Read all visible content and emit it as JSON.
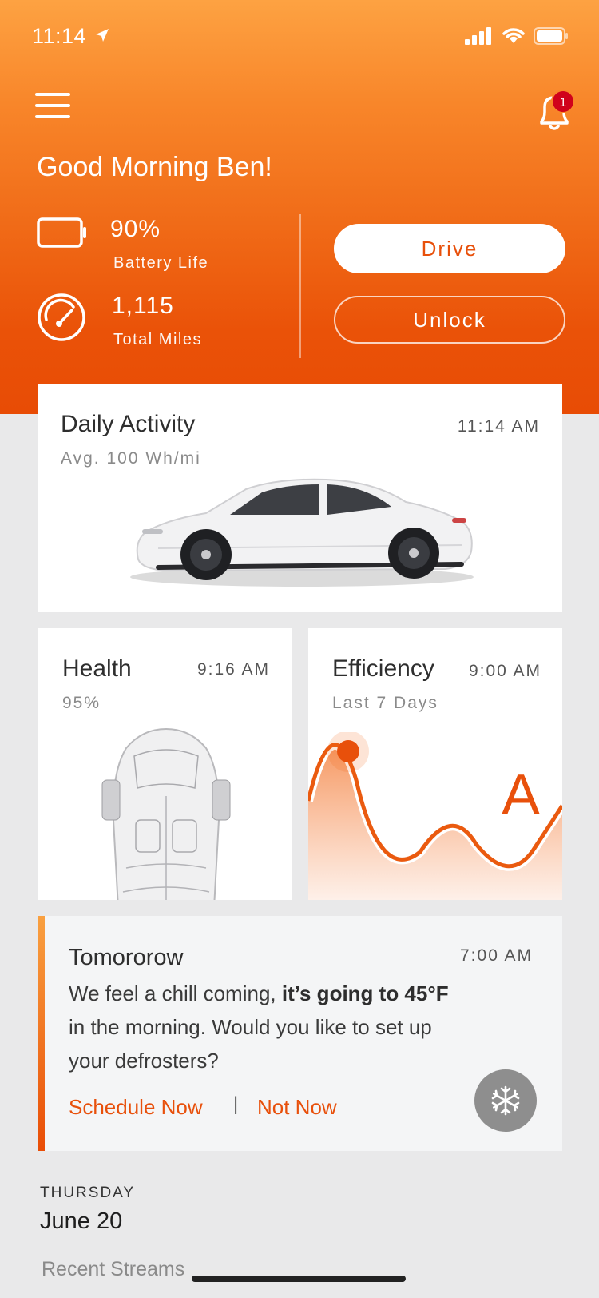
{
  "status": {
    "time": "11:14",
    "icons": [
      "location-arrow-icon",
      "signal-icon",
      "wifi-icon",
      "battery-icon"
    ]
  },
  "header": {
    "notification_count": "1",
    "greeting": "Good Morning Ben!"
  },
  "stats": {
    "battery_value": "90%",
    "battery_label": "Battery Life",
    "battery_fraction": 0.9,
    "miles_value": "1,115",
    "miles_label": "Total Miles"
  },
  "actions": {
    "drive_label": "Drive",
    "unlock_label": "Unlock"
  },
  "daily_activity": {
    "title": "Daily Activity",
    "time": "11:14 AM",
    "subtitle": "Avg. 100 Wh/mi"
  },
  "health": {
    "title": "Health",
    "time": "9:16 AM",
    "value": "95%"
  },
  "efficiency": {
    "title": "Efficiency",
    "time": "9:00 AM",
    "subtitle": "Last 7 Days",
    "grade": "A"
  },
  "tip": {
    "title": "Tomororow",
    "time": "7:00 AM",
    "body_part1": "We feel a chill coming, ",
    "body_bold1": "it’s going to 45°F",
    "body_part2": " in the morning. Would you like to set up your defrosters?",
    "schedule_label": "Schedule Now",
    "separator": "|",
    "dismiss_label": "Not Now"
  },
  "feed": {
    "day": "THURSDAY",
    "date": "June 20",
    "section": "Recent Streams"
  },
  "colors": {
    "accent": "#e8500b",
    "hero_top": "#fda242",
    "hero_bottom": "#e84c05",
    "badge": "#d0021b"
  }
}
